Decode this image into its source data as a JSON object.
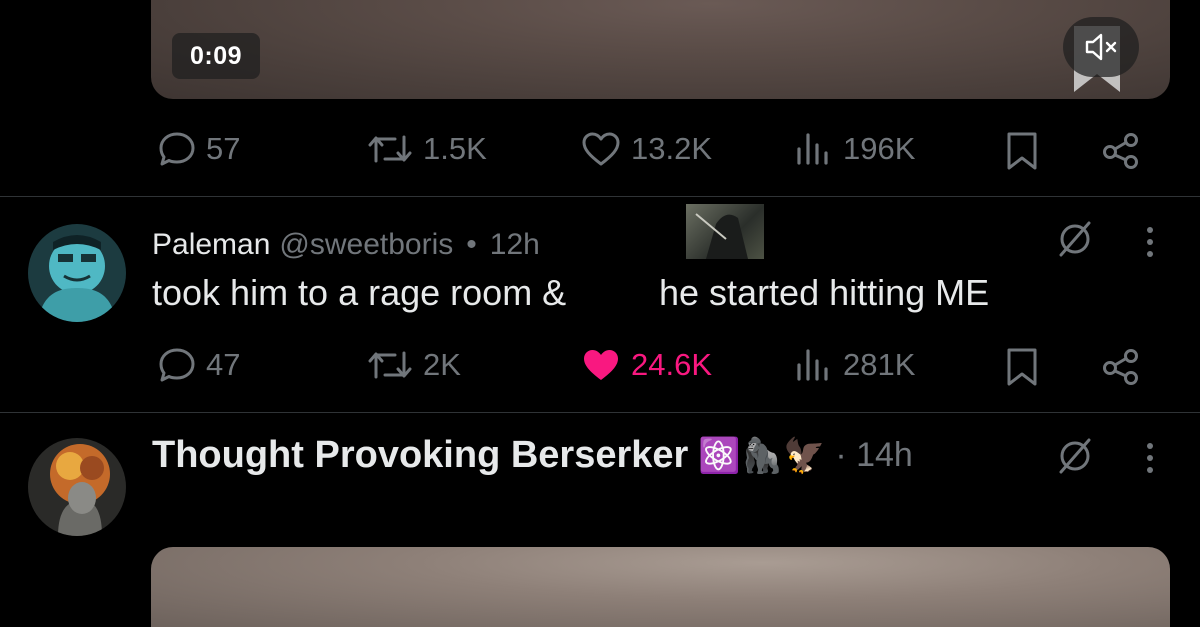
{
  "video1": {
    "timestamp": "0:09"
  },
  "tweet1_actions": {
    "replies": "57",
    "retweets": "1.5K",
    "likes": "13.2K",
    "views": "196K"
  },
  "tweet2": {
    "display_name": "Paleman",
    "handle": "@sweetboris",
    "separator": "•",
    "time": "12h",
    "text_part1": "took him to a rage room &",
    "text_part2": "he started hitting ME",
    "actions": {
      "replies": "47",
      "retweets": "2K",
      "likes": "24.6K",
      "views": "281K"
    }
  },
  "tweet3": {
    "display_name": "Thought Provoking Berserker",
    "emojis": "⚛️🦍🦅",
    "time": "· 14h"
  },
  "colors": {
    "text_primary": "#e7e9ea",
    "text_secondary": "#71767b",
    "like_active": "#f91880",
    "divider": "#2f3336",
    "background": "#000000"
  }
}
